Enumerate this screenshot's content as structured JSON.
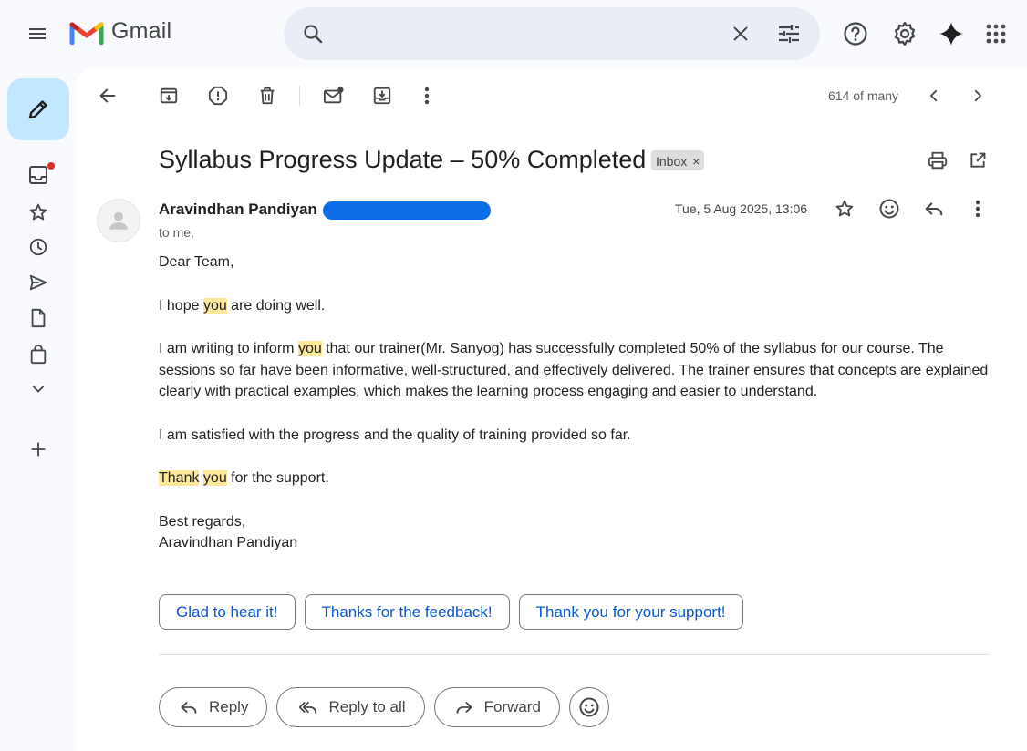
{
  "app": {
    "name": "Gmail",
    "colors": {
      "accent": "#0b57d0",
      "compose_bg": "#c2e7ff",
      "search_bg": "#e9eef6",
      "highlight": "#fde89a",
      "logo_red": "#ea4335",
      "logo_blue": "#4285f4",
      "logo_green": "#34a853",
      "logo_yellow": "#fbbc04"
    }
  },
  "topbar": {
    "icons": [
      "menu-icon",
      "search-icon",
      "clear-search-icon",
      "search-options-icon",
      "help-icon",
      "settings-icon",
      "gemini-icon",
      "apps-icon"
    ],
    "search": {
      "value": "",
      "placeholder": ""
    }
  },
  "rail": {
    "items": [
      "compose",
      "inbox",
      "starred",
      "snoozed",
      "sent",
      "drafts",
      "purchases",
      "more",
      "new-label"
    ],
    "inbox_has_unread": true
  },
  "toolbar": {
    "icons": [
      "back-icon",
      "archive-icon",
      "report-spam-icon",
      "delete-icon",
      "mark-unread-icon",
      "move-to-icon",
      "more-vert-icon"
    ],
    "pager": "614 of many"
  },
  "email": {
    "subject": "Syllabus Progress Update – 50% Completed",
    "label_chip": "Inbox",
    "chip_close": "×",
    "sender_name": "Aravindhan Pandiyan",
    "to": "to me,",
    "date": "Tue, 5 Aug 2025, 13:06",
    "body": {
      "greeting": "Dear Team,",
      "p1": {
        "a": "I hope ",
        "hl": "you",
        "b": " are doing well."
      },
      "p2": {
        "a": "I am writing to inform ",
        "hl": "you",
        "b": " that our trainer(Mr. Sanyog) has successfully completed 50% of the syllabus for our course. The sessions so far have been informative, well-structured, and effectively delivered. The trainer ensures that concepts are explained clearly with practical examples, which makes the learning process engaging and easier to understand."
      },
      "p3": "I am satisfied with the progress and the quality of training provided so far.",
      "p4": {
        "hl1": "Thank",
        "space": " ",
        "hl2": "you",
        "b": " for the support."
      },
      "closing": "Best regards,",
      "signature": "Aravindhan Pandiyan"
    }
  },
  "smart_replies": [
    "Glad to hear it!",
    "Thanks for the feedback!",
    "Thank you for your support!"
  ],
  "actions": {
    "reply": "Reply",
    "reply_all": "Reply to all",
    "forward": "Forward"
  }
}
